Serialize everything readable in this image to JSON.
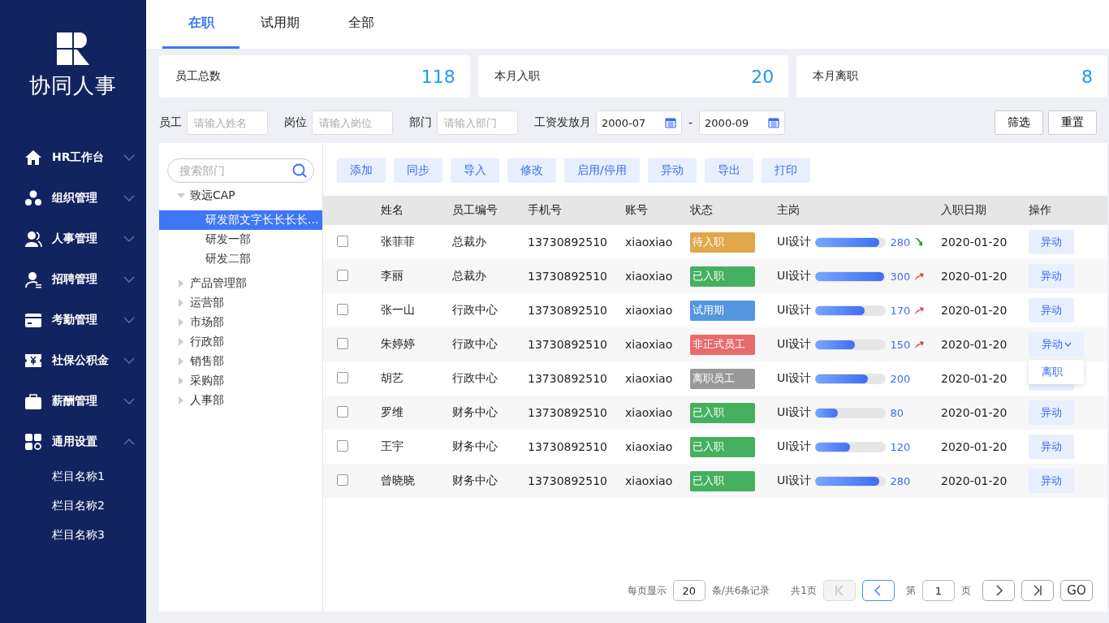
{
  "brand": {
    "name": "协同人事"
  },
  "sidebar": {
    "items": [
      {
        "label": "HR工作台",
        "kind": "home",
        "expanded": false
      },
      {
        "label": "组织管理",
        "kind": "org",
        "expanded": false
      },
      {
        "label": "人事管理",
        "kind": "people",
        "expanded": false
      },
      {
        "label": "招聘管理",
        "kind": "recruit",
        "expanded": false
      },
      {
        "label": "考勤管理",
        "kind": "card",
        "expanded": false
      },
      {
        "label": "社保公积金",
        "kind": "yen",
        "expanded": false
      },
      {
        "label": "薪酬管理",
        "kind": "case",
        "expanded": false
      },
      {
        "label": "通用设置",
        "kind": "grid",
        "expanded": true,
        "children": [
          {
            "label": "栏目名称1"
          },
          {
            "label": "栏目名称2"
          },
          {
            "label": "栏目名称3"
          }
        ]
      }
    ]
  },
  "tabs": [
    {
      "label": "在职",
      "selected": true
    },
    {
      "label": "试用期",
      "selected": false
    },
    {
      "label": "全部",
      "selected": false
    }
  ],
  "stats": [
    {
      "label": "员工总数",
      "value": "118"
    },
    {
      "label": "本月入职",
      "value": "20"
    },
    {
      "label": "本月离职",
      "value": "8"
    }
  ],
  "filters": {
    "fields": [
      {
        "label": "员工",
        "placeholder": "请输入姓名"
      },
      {
        "label": "岗位",
        "placeholder": "请输入岗位"
      },
      {
        "label": "部门",
        "placeholder": "请输入部门"
      }
    ],
    "month": {
      "label": "工资发放月",
      "from": "2000-07",
      "separator": "-",
      "to": "2000-09"
    },
    "buttons": [
      "筛选",
      "重置"
    ]
  },
  "tree": {
    "search": {
      "placeholder": "搜索部门"
    },
    "items": [
      {
        "label": "致远CAP",
        "expanded": true,
        "children": [
          {
            "label": "研发部文字长长长长...",
            "selected": true
          },
          {
            "label": "研发一部",
            "selected": false
          },
          {
            "label": "研发二部",
            "selected": false
          }
        ]
      },
      {
        "label": "产品管理部",
        "expanded": false
      },
      {
        "label": "运营部",
        "expanded": false
      },
      {
        "label": "市场部",
        "expanded": false
      },
      {
        "label": "行政部",
        "expanded": false
      },
      {
        "label": "销售部",
        "expanded": false
      },
      {
        "label": "采购部",
        "expanded": false
      },
      {
        "label": "人事部",
        "expanded": false
      }
    ]
  },
  "toolbar": [
    "添加",
    "同步",
    "导入",
    "修改",
    "启用/停用",
    "异动",
    "导出",
    "打印"
  ],
  "table": {
    "columns": [
      "姓名",
      "员工编号",
      "手机号",
      "账号",
      "状态",
      "主岗",
      "入职日期",
      "操作"
    ],
    "rows": [
      {
        "checked": false,
        "name": "张菲菲",
        "dept": "总裁办",
        "phone": "13730892510",
        "account": "xiaoxiao",
        "status": "待入职",
        "color": "#e0a84a",
        "post": "UI设计",
        "level": 0.93,
        "score": "280",
        "kind": "down",
        "date": "2020-01-20",
        "action": "异动"
      },
      {
        "checked": false,
        "name": "李丽",
        "dept": "总裁办",
        "phone": "13730892510",
        "account": "xiaoxiao",
        "status": "已入职",
        "color": "#45b060",
        "post": "UI设计",
        "level": 1,
        "score": "300",
        "kind": "up",
        "date": "2020-01-20",
        "action": "异动"
      },
      {
        "checked": false,
        "name": "张一山",
        "dept": "行政中心",
        "phone": "13730892510",
        "account": "xiaoxiao",
        "status": "试用期",
        "color": "#5596e0",
        "post": "UI设计",
        "level": 0.71,
        "score": "170",
        "kind": "up",
        "date": "2020-01-20",
        "action": "异动"
      },
      {
        "checked": false,
        "name": "朱婷婷",
        "dept": "行政中心",
        "phone": "13730892510",
        "account": "xiaoxiao",
        "status": "非正式员工",
        "color": "#e86a6a",
        "post": "UI设计",
        "level": 0.57,
        "score": "150",
        "kind": "up",
        "date": "2020-01-20",
        "action": "异动",
        "menu_open": true,
        "menu": [
          "离职"
        ]
      },
      {
        "checked": false,
        "name": "胡艺",
        "dept": "行政中心",
        "phone": "13730892510",
        "account": "xiaoxiao",
        "status": "离职员工",
        "color": "#999999",
        "post": "UI设计",
        "level": 0.76,
        "score": "200",
        "kind": "plain",
        "date": "2020-01-20"
      },
      {
        "checked": false,
        "name": "罗维",
        "dept": "财务中心",
        "phone": "13730892510",
        "account": "xiaoxiao",
        "status": "已入职",
        "color": "#45b060",
        "post": "UI设计",
        "level": 0.32,
        "score": "80",
        "kind": "plain",
        "date": "2020-01-20",
        "action": "异动"
      },
      {
        "checked": false,
        "name": "王宇",
        "dept": "财务中心",
        "phone": "13730892510",
        "account": "xiaoxiao",
        "status": "已入职",
        "color": "#45b060",
        "post": "UI设计",
        "level": 0.5,
        "score": "120",
        "kind": "plain",
        "date": "2020-01-20",
        "action": "异动"
      },
      {
        "checked": false,
        "name": "曾晓晓",
        "dept": "财务中心",
        "phone": "13730892510",
        "account": "xiaoxiao",
        "status": "已入职",
        "color": "#45b060",
        "post": "UI设计",
        "level": 0.93,
        "score": "280",
        "kind": "plain",
        "date": "2020-01-20",
        "action": "异动"
      }
    ]
  },
  "pagination": {
    "per_page_label": "每页显示",
    "per_page": "20",
    "records": "条/共6条记录",
    "pages": "共1页",
    "first_disabled": true,
    "page_prefix": "第",
    "page": "1",
    "page_suffix": "页",
    "go": "GO"
  }
}
